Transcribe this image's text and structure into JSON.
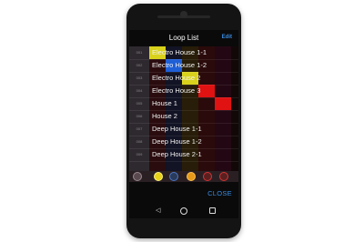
{
  "dialog": {
    "title": "Loop List",
    "edit_label": "Edit",
    "close_label": "CLOSE"
  },
  "loops": [
    {
      "number": "001",
      "name": "Electro House 1-1"
    },
    {
      "number": "002",
      "name": "Electro House 1-2"
    },
    {
      "number": "003",
      "name": "Electro House 2"
    },
    {
      "number": "004",
      "name": "Electro House 3"
    },
    {
      "number": "005",
      "name": "House 1"
    },
    {
      "number": "006",
      "name": "House 2"
    },
    {
      "number": "007",
      "name": "Deep House 1-1"
    },
    {
      "number": "008",
      "name": "Deep House 1-2"
    },
    {
      "number": "009",
      "name": "Deep House 2-1"
    }
  ],
  "colors": {
    "accent": "#3a8be0",
    "pad_yellow": "#d9d21c",
    "pad_blue": "#1f5fd6",
    "pad_red": "#e01212",
    "control_yellow": "#e8d21a",
    "control_orange": "#e59a1a",
    "control_red": "#d63434",
    "control_blue": "#4a78c8"
  },
  "icons": {
    "back": "triangle-back-icon",
    "home": "circle-home-icon",
    "recent": "square-recent-icon"
  }
}
